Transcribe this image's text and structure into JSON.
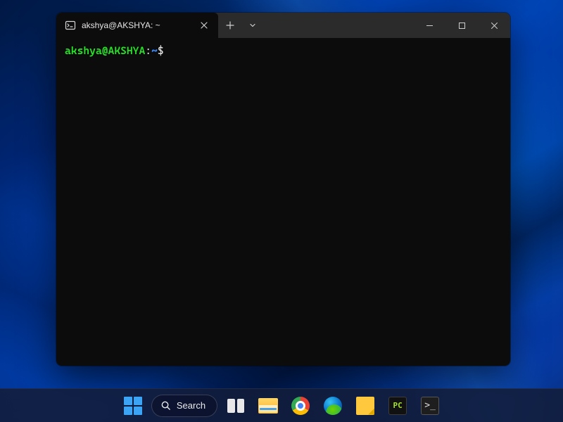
{
  "window": {
    "tab_title": "akshya@AKSHYA: ~"
  },
  "prompt": {
    "user_host": "akshya@AKSHYA",
    "separator": ":",
    "path": "~",
    "symbol": "$"
  },
  "taskbar": {
    "search_label": "Search",
    "pycharm_label": "PC"
  }
}
